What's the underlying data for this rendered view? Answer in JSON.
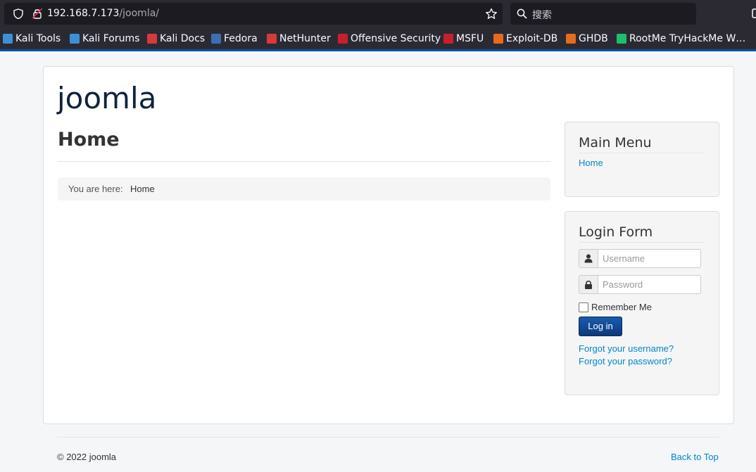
{
  "browser": {
    "url_host": "192.168.7.173",
    "url_path": "/joomla/",
    "search_placeholder": "搜索",
    "bookmarks": [
      {
        "label": "Kali Tools",
        "icon": "kali-icon",
        "color": "#3d8fd6"
      },
      {
        "label": "Kali Forums",
        "icon": "kali-icon",
        "color": "#3d8fd6"
      },
      {
        "label": "Kali Docs",
        "icon": "kali-docs-icon",
        "color": "#d63b3b"
      },
      {
        "label": "Fedora",
        "icon": "fedora-icon",
        "color": "#3c6eb4"
      },
      {
        "label": "NetHunter",
        "icon": "nethunter-icon",
        "color": "#d63b3b"
      },
      {
        "label": "Offensive Security",
        "icon": "offsec-icon",
        "color": "#c8202a"
      },
      {
        "label": "MSFU",
        "icon": "msfu-icon",
        "color": "#c8202a"
      },
      {
        "label": "Exploit-DB",
        "icon": "exploitdb-icon",
        "color": "#e66b1c"
      },
      {
        "label": "GHDB",
        "icon": "ghdb-icon",
        "color": "#e66b1c"
      },
      {
        "label": "RootMe TryHackMe W…",
        "icon": "rootme-icon",
        "color": "#1fbf6a"
      }
    ]
  },
  "site": {
    "brand": "joomla",
    "page_title": "Home",
    "breadcrumb_label": "You are here:",
    "breadcrumb_current": "Home"
  },
  "main_menu": {
    "title": "Main Menu",
    "items": [
      "Home"
    ]
  },
  "login_form": {
    "title": "Login Form",
    "username_placeholder": "Username",
    "password_placeholder": "Password",
    "remember_label": "Remember Me",
    "login_button": "Log in",
    "forgot_username": "Forgot your username?",
    "forgot_password": "Forgot your password?"
  },
  "footer": {
    "copyright": "© 2022 joomla",
    "back_to_top": "Back to Top"
  }
}
